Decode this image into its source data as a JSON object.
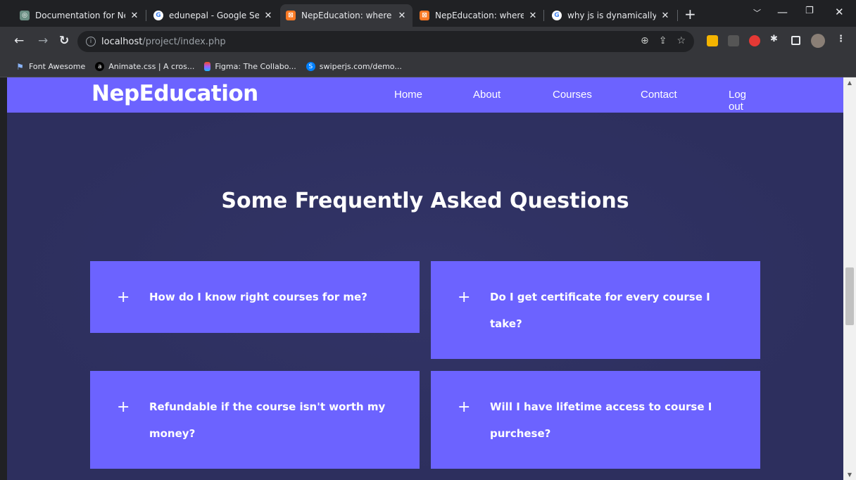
{
  "browser": {
    "tabs": [
      {
        "title": "Documentation for NepE",
        "favicon": "chatgpt-icon",
        "active": false
      },
      {
        "title": "edunepal - Google Search",
        "favicon": "google-icon",
        "active": false
      },
      {
        "title": "NepEducation: where lear",
        "favicon": "xampp-icon",
        "active": true
      },
      {
        "title": "NepEducation: where",
        "favicon": "xampp-icon",
        "active": false
      },
      {
        "title": "why js is dynamically type",
        "favicon": "google-icon",
        "active": false
      }
    ],
    "new_tab_label": "+",
    "url_host": "localhost",
    "url_path": "/project/index.php",
    "bookmarks": [
      {
        "label": "Font Awesome",
        "icon": "flag-icon"
      },
      {
        "label": "Animate.css | A cros...",
        "icon": "animate-icon"
      },
      {
        "label": "Figma: The Collabo...",
        "icon": "figma-icon"
      },
      {
        "label": "swiperjs.com/demo...",
        "icon": "swiper-icon"
      }
    ]
  },
  "site": {
    "brand": "NepEducation",
    "nav": [
      "Home",
      "About",
      "Courses",
      "Contact",
      "Log out"
    ],
    "faq_title": "Some Frequently Asked Questions",
    "faqs": [
      {
        "lines": [
          "How do I know right courses for me?"
        ]
      },
      {
        "lines": [
          "Do I get certificate for every course I",
          "take?"
        ]
      },
      {
        "lines": [
          "Refundable if the course isn't worth my",
          "money?"
        ]
      },
      {
        "lines": [
          "Will I have lifetime access to course I",
          "purchese?"
        ]
      }
    ],
    "expand_symbol": "+"
  },
  "colors": {
    "accent": "#6c63ff",
    "background": "#2d2f5e"
  }
}
